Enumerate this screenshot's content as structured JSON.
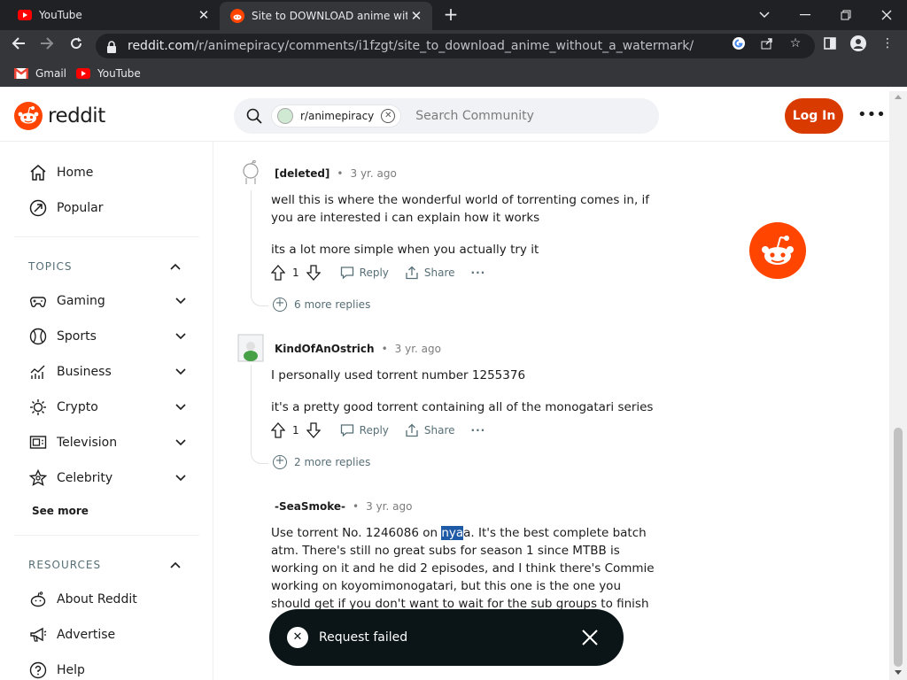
{
  "browser": {
    "tabs": [
      {
        "title": "YouTube"
      },
      {
        "title": "Site to DOWNLOAD anime witho"
      }
    ],
    "url_host": "reddit.com",
    "url_path": "/r/animepiracy/comments/i1fzgt/site_to_download_anime_without_a_watermark/",
    "bookmarks": [
      {
        "label": "Gmail"
      },
      {
        "label": "YouTube"
      }
    ]
  },
  "header": {
    "logo_text": "reddit",
    "community_chip": "r/animepiracy",
    "search_placeholder": "Search Community",
    "login_label": "Log In"
  },
  "sidebar": {
    "home": "Home",
    "popular": "Popular",
    "topics_heading": "TOPICS",
    "topics": [
      "Gaming",
      "Sports",
      "Business",
      "Crypto",
      "Television",
      "Celebrity"
    ],
    "see_more": "See more",
    "resources_heading": "RESOURCES",
    "resources": [
      "About Reddit",
      "Advertise",
      "Help"
    ]
  },
  "comments": [
    {
      "author": "[deleted]",
      "age": "3 yr. ago",
      "paragraphs": [
        "well this is where the wonderful world of torrenting comes in, if you are interested i can explain how it works",
        "its a lot more simple when you actually try it"
      ],
      "votes": "1",
      "reply_label": "Reply",
      "share_label": "Share",
      "more_replies": "6 more replies"
    },
    {
      "author": "KindOfAnOstrich",
      "age": "3 yr. ago",
      "paragraphs": [
        "I personally used torrent number 1255376",
        "it's a pretty good torrent containing all of the monogatari series"
      ],
      "votes": "1",
      "reply_label": "Reply",
      "share_label": "Share",
      "more_replies": "2 more replies"
    },
    {
      "author": "-SeaSmoke-",
      "age": "3 yr. ago",
      "text_before": "Use torrent No. 1246086 on ",
      "text_highlight": "nya",
      "text_after": "a. It's the best complete batch atm. There's still no great subs for season 1 since MTBB is working on it and he did 2 episodes, and I think there's Commie working on koyomimonogatari, but this one is the one you should get if you don't want to wait for the sub groups to finish"
    }
  ],
  "toast": {
    "message": "Request failed"
  },
  "colors": {
    "brand": "#ff4500",
    "login": "#d93a00",
    "toast_bg": "#0b1416"
  }
}
